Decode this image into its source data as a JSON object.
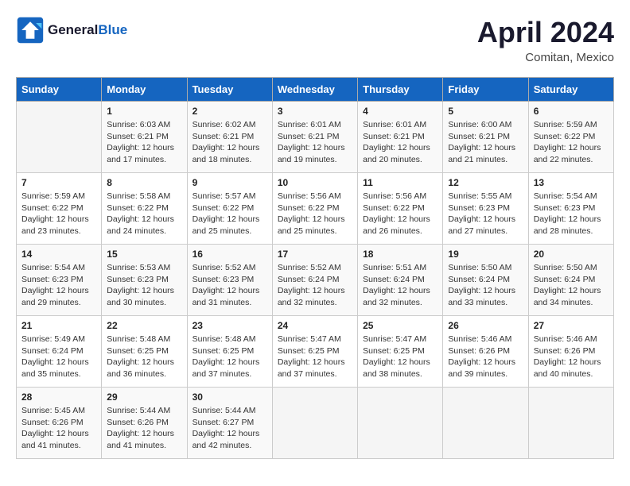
{
  "header": {
    "logo_line1": "General",
    "logo_line2": "Blue",
    "month": "April 2024",
    "location": "Comitan, Mexico"
  },
  "weekdays": [
    "Sunday",
    "Monday",
    "Tuesday",
    "Wednesday",
    "Thursday",
    "Friday",
    "Saturday"
  ],
  "weeks": [
    [
      {
        "day": "",
        "info": ""
      },
      {
        "day": "1",
        "info": "Sunrise: 6:03 AM\nSunset: 6:21 PM\nDaylight: 12 hours\nand 17 minutes."
      },
      {
        "day": "2",
        "info": "Sunrise: 6:02 AM\nSunset: 6:21 PM\nDaylight: 12 hours\nand 18 minutes."
      },
      {
        "day": "3",
        "info": "Sunrise: 6:01 AM\nSunset: 6:21 PM\nDaylight: 12 hours\nand 19 minutes."
      },
      {
        "day": "4",
        "info": "Sunrise: 6:01 AM\nSunset: 6:21 PM\nDaylight: 12 hours\nand 20 minutes."
      },
      {
        "day": "5",
        "info": "Sunrise: 6:00 AM\nSunset: 6:21 PM\nDaylight: 12 hours\nand 21 minutes."
      },
      {
        "day": "6",
        "info": "Sunrise: 5:59 AM\nSunset: 6:22 PM\nDaylight: 12 hours\nand 22 minutes."
      }
    ],
    [
      {
        "day": "7",
        "info": "Sunrise: 5:59 AM\nSunset: 6:22 PM\nDaylight: 12 hours\nand 23 minutes."
      },
      {
        "day": "8",
        "info": "Sunrise: 5:58 AM\nSunset: 6:22 PM\nDaylight: 12 hours\nand 24 minutes."
      },
      {
        "day": "9",
        "info": "Sunrise: 5:57 AM\nSunset: 6:22 PM\nDaylight: 12 hours\nand 25 minutes."
      },
      {
        "day": "10",
        "info": "Sunrise: 5:56 AM\nSunset: 6:22 PM\nDaylight: 12 hours\nand 25 minutes."
      },
      {
        "day": "11",
        "info": "Sunrise: 5:56 AM\nSunset: 6:22 PM\nDaylight: 12 hours\nand 26 minutes."
      },
      {
        "day": "12",
        "info": "Sunrise: 5:55 AM\nSunset: 6:23 PM\nDaylight: 12 hours\nand 27 minutes."
      },
      {
        "day": "13",
        "info": "Sunrise: 5:54 AM\nSunset: 6:23 PM\nDaylight: 12 hours\nand 28 minutes."
      }
    ],
    [
      {
        "day": "14",
        "info": "Sunrise: 5:54 AM\nSunset: 6:23 PM\nDaylight: 12 hours\nand 29 minutes."
      },
      {
        "day": "15",
        "info": "Sunrise: 5:53 AM\nSunset: 6:23 PM\nDaylight: 12 hours\nand 30 minutes."
      },
      {
        "day": "16",
        "info": "Sunrise: 5:52 AM\nSunset: 6:23 PM\nDaylight: 12 hours\nand 31 minutes."
      },
      {
        "day": "17",
        "info": "Sunrise: 5:52 AM\nSunset: 6:24 PM\nDaylight: 12 hours\nand 32 minutes."
      },
      {
        "day": "18",
        "info": "Sunrise: 5:51 AM\nSunset: 6:24 PM\nDaylight: 12 hours\nand 32 minutes."
      },
      {
        "day": "19",
        "info": "Sunrise: 5:50 AM\nSunset: 6:24 PM\nDaylight: 12 hours\nand 33 minutes."
      },
      {
        "day": "20",
        "info": "Sunrise: 5:50 AM\nSunset: 6:24 PM\nDaylight: 12 hours\nand 34 minutes."
      }
    ],
    [
      {
        "day": "21",
        "info": "Sunrise: 5:49 AM\nSunset: 6:24 PM\nDaylight: 12 hours\nand 35 minutes."
      },
      {
        "day": "22",
        "info": "Sunrise: 5:48 AM\nSunset: 6:25 PM\nDaylight: 12 hours\nand 36 minutes."
      },
      {
        "day": "23",
        "info": "Sunrise: 5:48 AM\nSunset: 6:25 PM\nDaylight: 12 hours\nand 37 minutes."
      },
      {
        "day": "24",
        "info": "Sunrise: 5:47 AM\nSunset: 6:25 PM\nDaylight: 12 hours\nand 37 minutes."
      },
      {
        "day": "25",
        "info": "Sunrise: 5:47 AM\nSunset: 6:25 PM\nDaylight: 12 hours\nand 38 minutes."
      },
      {
        "day": "26",
        "info": "Sunrise: 5:46 AM\nSunset: 6:26 PM\nDaylight: 12 hours\nand 39 minutes."
      },
      {
        "day": "27",
        "info": "Sunrise: 5:46 AM\nSunset: 6:26 PM\nDaylight: 12 hours\nand 40 minutes."
      }
    ],
    [
      {
        "day": "28",
        "info": "Sunrise: 5:45 AM\nSunset: 6:26 PM\nDaylight: 12 hours\nand 41 minutes."
      },
      {
        "day": "29",
        "info": "Sunrise: 5:44 AM\nSunset: 6:26 PM\nDaylight: 12 hours\nand 41 minutes."
      },
      {
        "day": "30",
        "info": "Sunrise: 5:44 AM\nSunset: 6:27 PM\nDaylight: 12 hours\nand 42 minutes."
      },
      {
        "day": "",
        "info": ""
      },
      {
        "day": "",
        "info": ""
      },
      {
        "day": "",
        "info": ""
      },
      {
        "day": "",
        "info": ""
      }
    ]
  ]
}
